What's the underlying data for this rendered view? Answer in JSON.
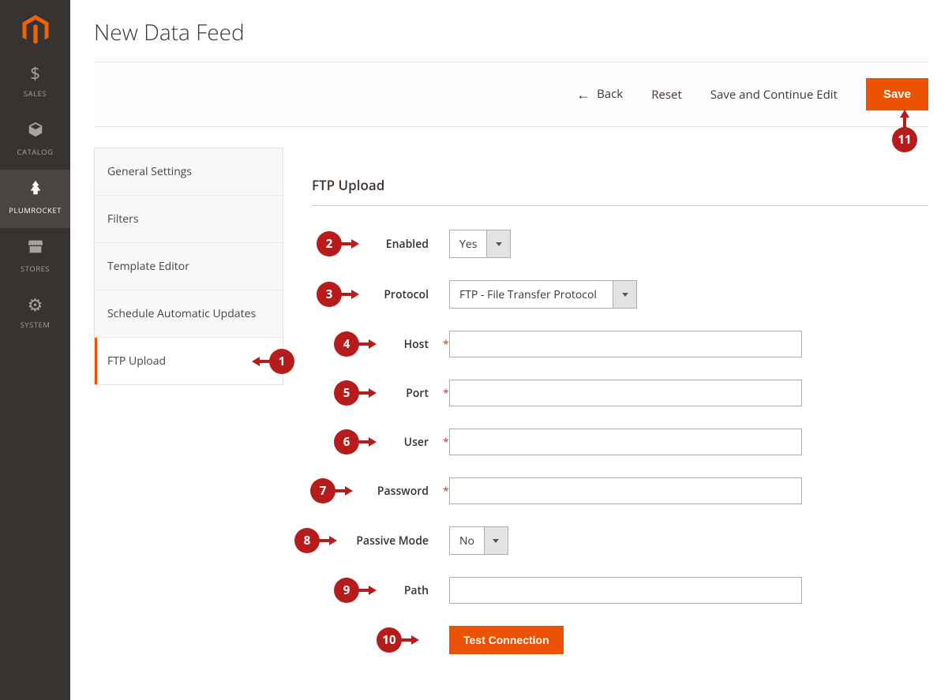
{
  "nav": {
    "items": [
      {
        "label": "SALES",
        "icon": "$"
      },
      {
        "label": "CATALOG",
        "icon": "cube"
      },
      {
        "label": "PLUMROCKET",
        "icon": "tree"
      },
      {
        "label": "STORES",
        "icon": "store"
      },
      {
        "label": "SYSTEM",
        "icon": "gear"
      }
    ]
  },
  "page": {
    "title": "New Data Feed"
  },
  "actions": {
    "back": "Back",
    "reset": "Reset",
    "save_continue": "Save and Continue Edit",
    "save": "Save"
  },
  "sidebar": {
    "tabs": [
      {
        "label": "General Settings"
      },
      {
        "label": "Filters"
      },
      {
        "label": "Template Editor"
      },
      {
        "label": "Schedule Automatic Updates"
      },
      {
        "label": "FTP Upload"
      }
    ]
  },
  "form": {
    "title": "FTP Upload",
    "enabled": {
      "label": "Enabled",
      "value": "Yes"
    },
    "protocol": {
      "label": "Protocol",
      "value": "FTP - File Transfer Protocol"
    },
    "host": {
      "label": "Host",
      "value": ""
    },
    "port": {
      "label": "Port",
      "value": ""
    },
    "user": {
      "label": "User",
      "value": ""
    },
    "password": {
      "label": "Password",
      "value": ""
    },
    "passive": {
      "label": "Passive Mode",
      "value": "No"
    },
    "path": {
      "label": "Path",
      "value": ""
    },
    "test_btn": "Test Connection"
  },
  "annotations": {
    "n1": "1",
    "n2": "2",
    "n3": "3",
    "n4": "4",
    "n5": "5",
    "n6": "6",
    "n7": "7",
    "n8": "8",
    "n9": "9",
    "n10": "10",
    "n11": "11"
  }
}
